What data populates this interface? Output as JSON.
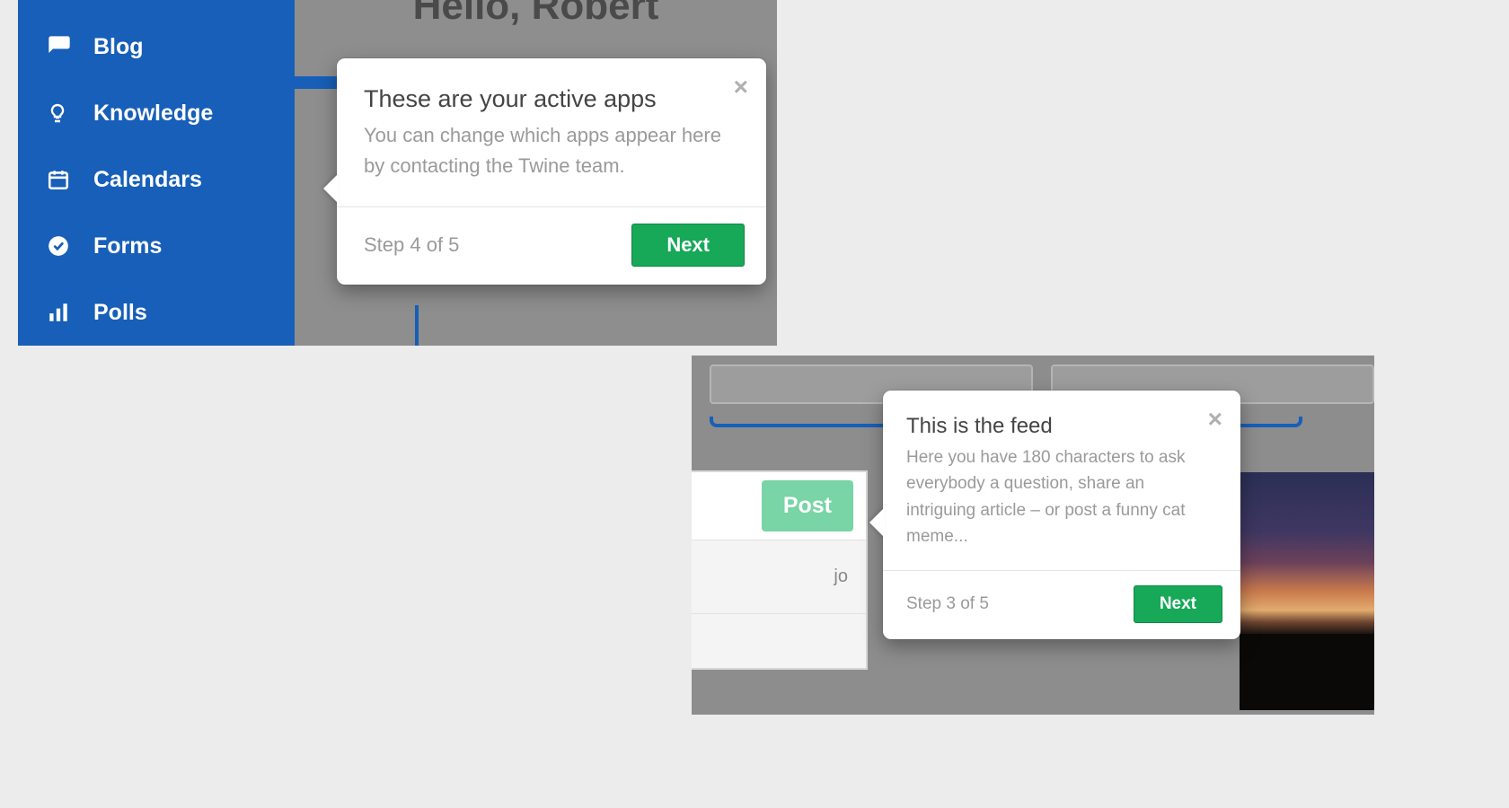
{
  "panel1": {
    "greeting": "Hello, Robert",
    "sidebar": {
      "items": [
        {
          "key": "blog",
          "label": "Blog",
          "icon": "chat-icon"
        },
        {
          "key": "knowledge",
          "label": "Knowledge",
          "icon": "bulb-icon"
        },
        {
          "key": "calendars",
          "label": "Calendars",
          "icon": "calendar-icon"
        },
        {
          "key": "forms",
          "label": "Forms",
          "icon": "check-circle-icon"
        },
        {
          "key": "polls",
          "label": "Polls",
          "icon": "bar-chart-icon"
        }
      ]
    },
    "popover": {
      "title": "These are your active apps",
      "body": "You can change which apps appear here by contacting the Twine team.",
      "step": "Step 4 of 5",
      "next": "Next"
    }
  },
  "panel2": {
    "post_button": "Post",
    "row_suffix": "jo",
    "popover": {
      "title": "This is the feed",
      "body": "Here you have 180 characters to ask everybody a question, share an intriguing article – or post a funny cat meme...",
      "step": "Step 3 of 5",
      "next": "Next"
    }
  }
}
